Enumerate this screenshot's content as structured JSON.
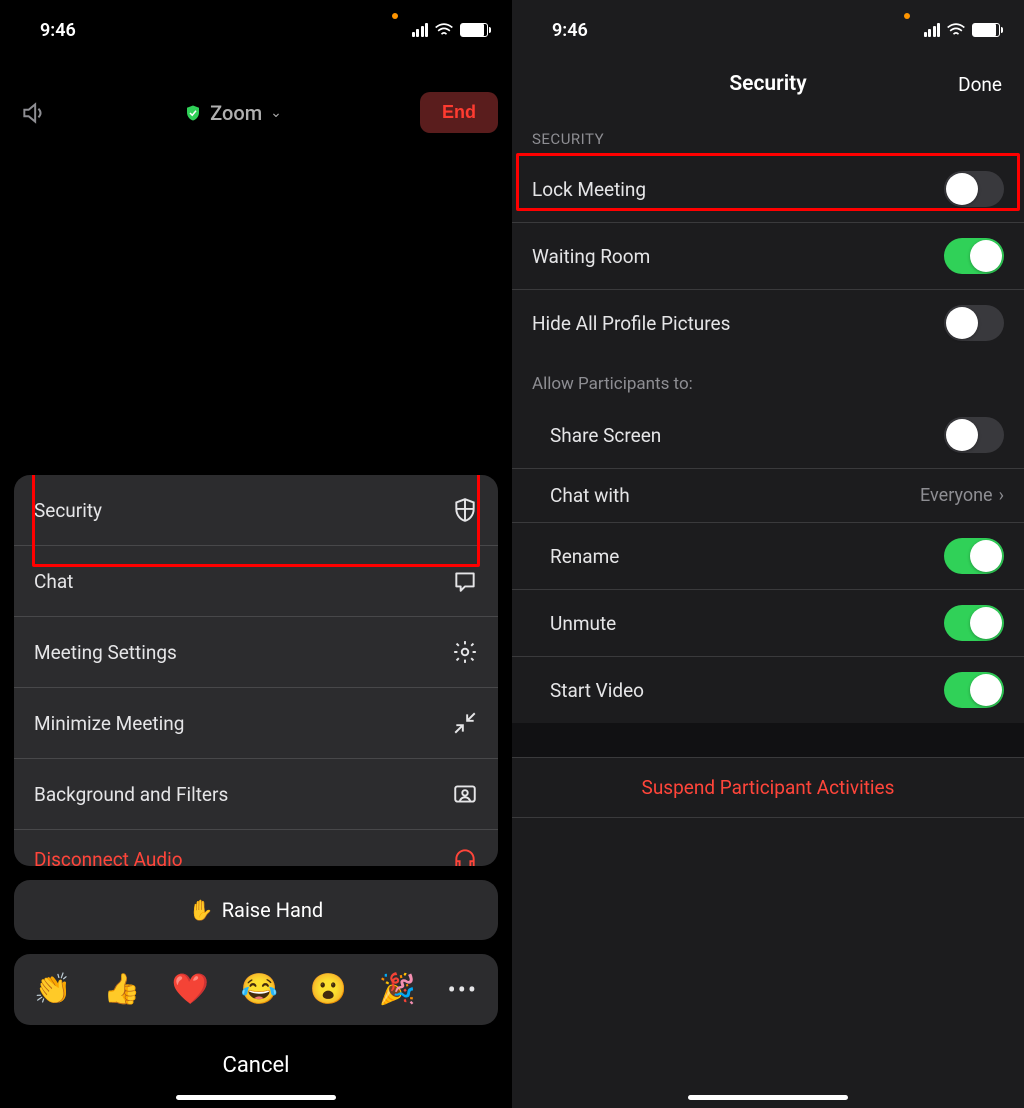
{
  "status": {
    "time": "9:46"
  },
  "left": {
    "title": "Zoom",
    "end_label": "End",
    "menu": {
      "security": "Security",
      "chat": "Chat",
      "settings": "Meeting Settings",
      "minimize": "Minimize Meeting",
      "background": "Background and Filters",
      "disconnect": "Disconnect Audio"
    },
    "raise_hand": "Raise Hand",
    "reactions": [
      "👏",
      "👍",
      "❤️",
      "😂",
      "😮",
      "🎉"
    ],
    "cancel": "Cancel"
  },
  "right": {
    "title": "Security",
    "done": "Done",
    "section": "SECURITY",
    "rows": {
      "lock": "Lock Meeting",
      "waiting": "Waiting Room",
      "hide": "Hide All Profile Pictures"
    },
    "allow_label": "Allow Participants to:",
    "allow": {
      "share": "Share Screen",
      "chat": "Chat with",
      "chat_value": "Everyone",
      "rename": "Rename",
      "unmute": "Unmute",
      "video": "Start Video"
    },
    "suspend": "Suspend Participant Activities"
  }
}
